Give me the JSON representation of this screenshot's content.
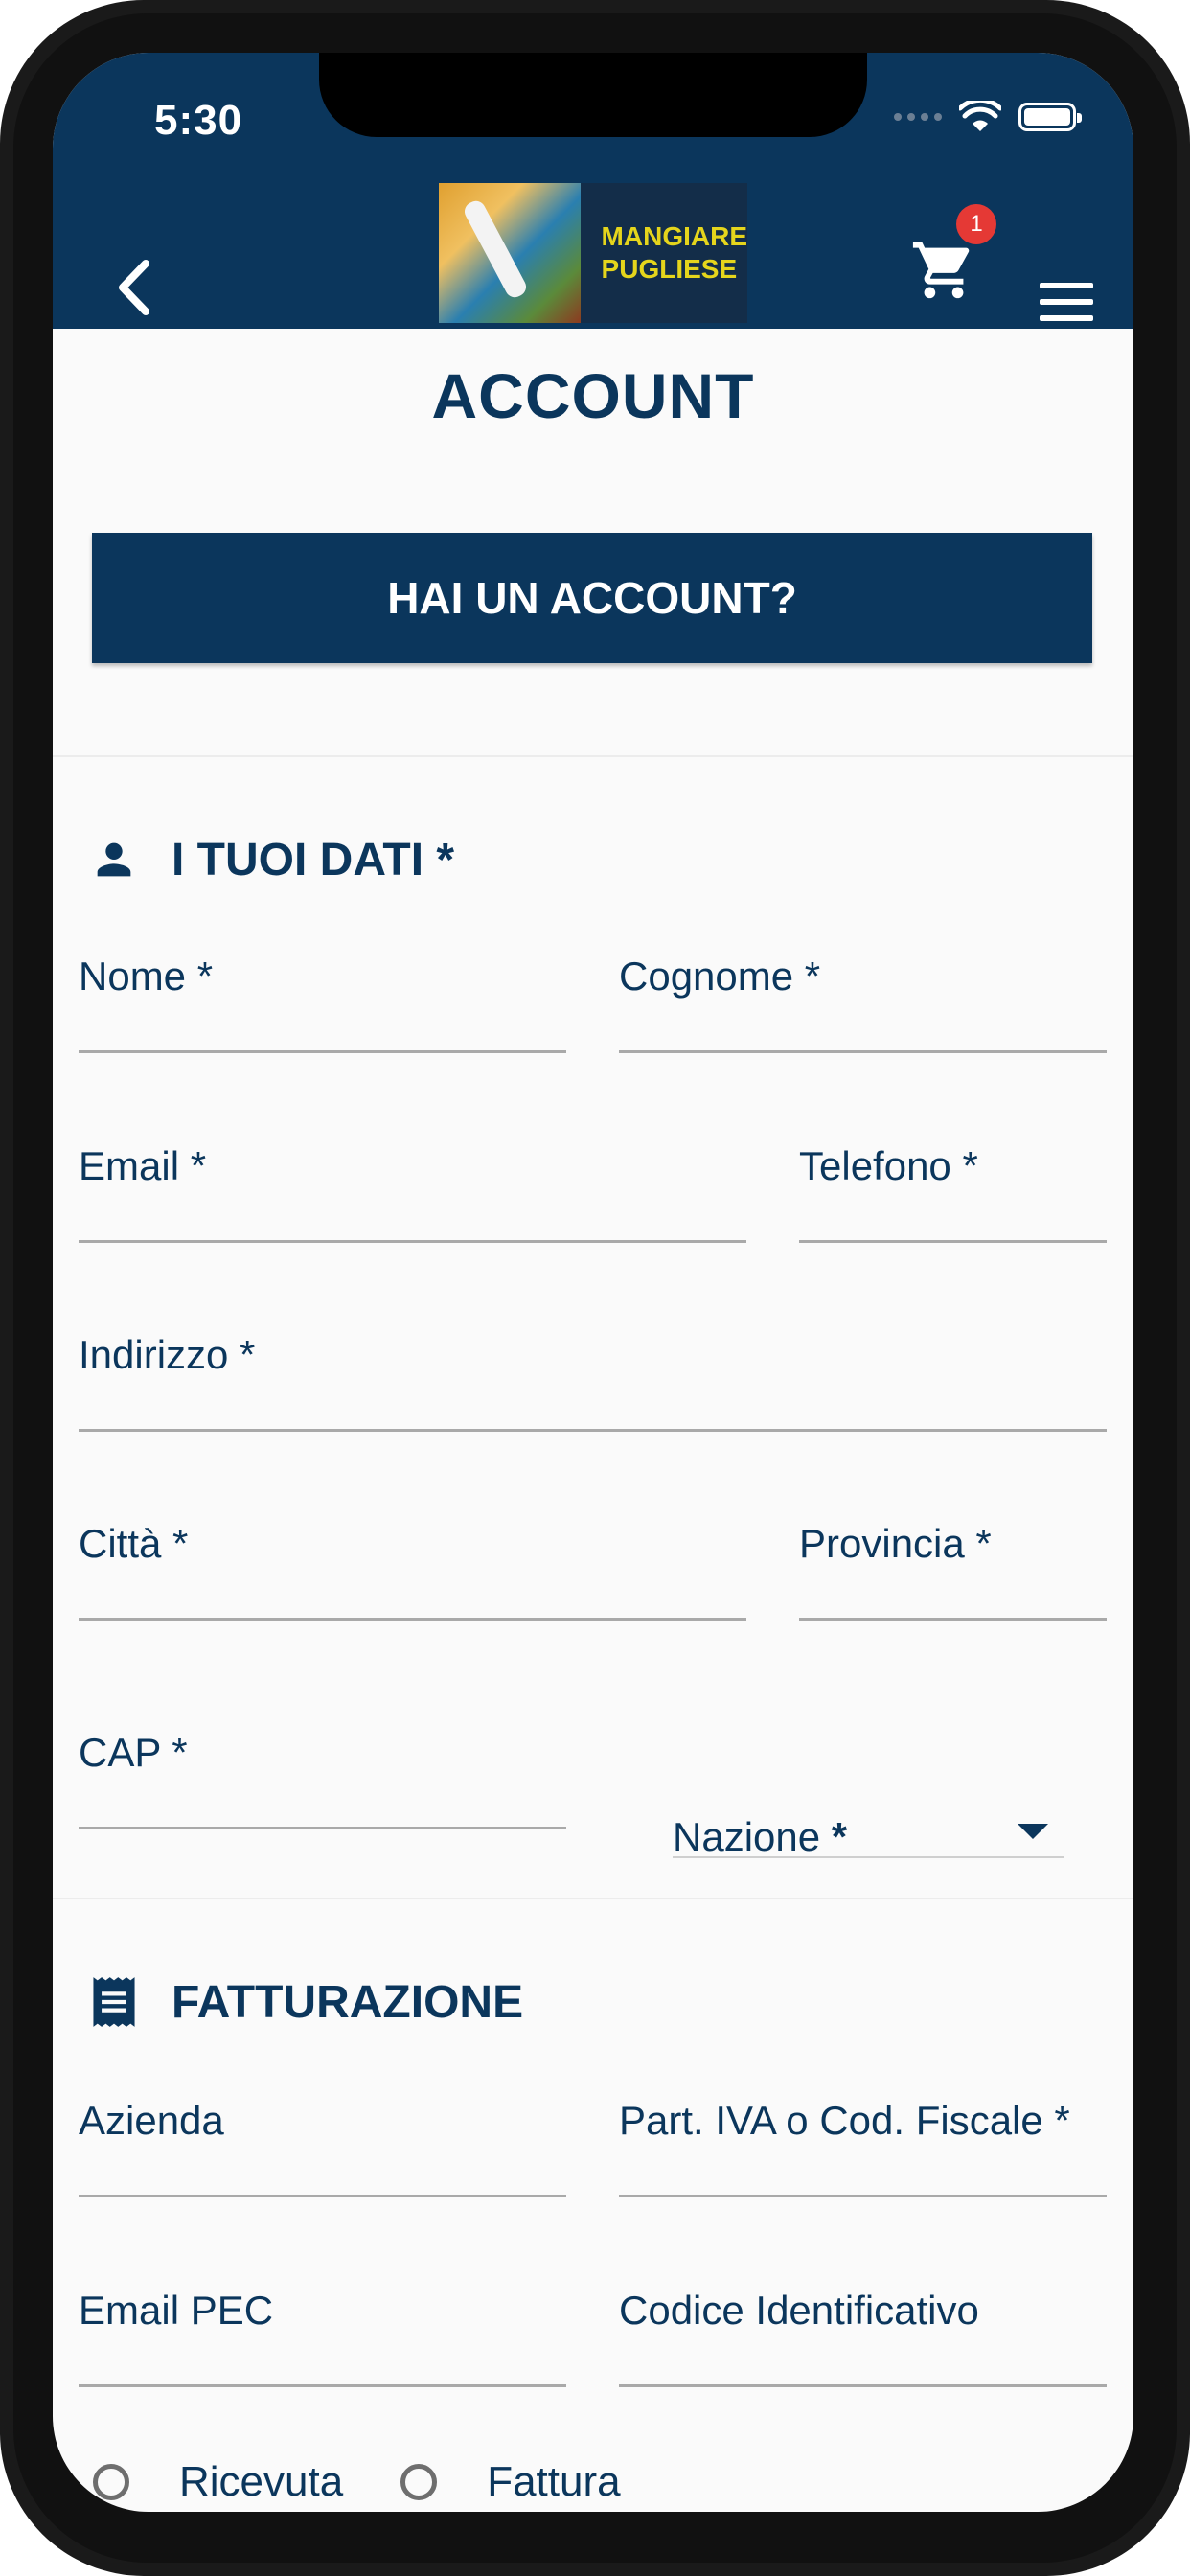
{
  "status_bar": {
    "time": "5:30"
  },
  "app_bar": {
    "logo_text_line1": "MANGIARE",
    "logo_text_line2": "PUGLIESE",
    "cart_count": "1"
  },
  "page": {
    "title": "ACCOUNT",
    "have_account_button": "HAI UN ACCOUNT?"
  },
  "personal_section": {
    "title": "I TUOI DATI *",
    "fields": {
      "nome": "Nome *",
      "cognome": "Cognome *",
      "email": "Email *",
      "telefono": "Telefono *",
      "indirizzo": "Indirizzo *",
      "citta": "Città *",
      "provincia": "Provincia *",
      "cap": "CAP *",
      "nazione": "Nazione",
      "nazione_star": "*"
    }
  },
  "billing_section": {
    "title": "FATTURAZIONE",
    "fields": {
      "azienda": "Azienda",
      "piva": "Part. IVA o Cod. Fiscale *",
      "email_pec": "Email PEC",
      "codice": "Codice Identificativo"
    },
    "radio_options": [
      "Ricevuta",
      "Fattura"
    ]
  },
  "colors": {
    "navy": "#0b365c",
    "badge": "#e53935",
    "logo_text": "#e5d51c"
  }
}
